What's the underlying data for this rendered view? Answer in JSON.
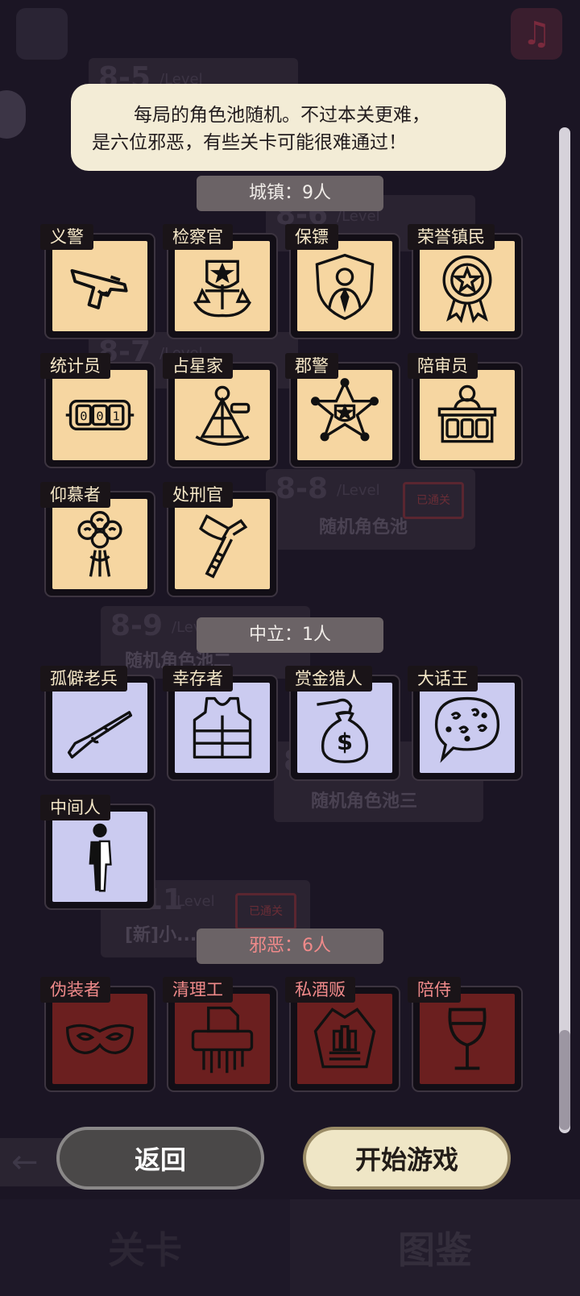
{
  "background": {
    "levels": [
      {
        "num": "8-5",
        "level_text": "/Level",
        "name": ""
      },
      {
        "num": "8-6",
        "level_text": "/Level",
        "name": ""
      },
      {
        "num": "8-7",
        "level_text": "/Level",
        "name": ""
      },
      {
        "num": "8-8",
        "level_text": "/Level",
        "name": "随机角色池"
      },
      {
        "num": "8-9",
        "level_text": "/Level",
        "name": "随机角色池二"
      },
      {
        "num": "8-10",
        "level_text": "",
        "name": "随机角色池三"
      },
      {
        "num": "8-11",
        "level_text": "/Level",
        "name": "[新]小..."
      }
    ],
    "stamp_text": "已通关",
    "tabs": [
      "关卡",
      "图鉴"
    ]
  },
  "tip": {
    "line1": "每局的角色池随机。不过本关更难，",
    "line2": "是六位邪恶，有些关卡可能很难通过！"
  },
  "sections": {
    "town": {
      "label": "城镇：9人"
    },
    "neutral": {
      "label": "中立：1人"
    },
    "evil": {
      "label": "邪恶：6人"
    }
  },
  "roles": {
    "town": [
      {
        "name": "义警",
        "icon": "pistol-icon"
      },
      {
        "name": "检察官",
        "icon": "justice-emblem-icon"
      },
      {
        "name": "保镖",
        "icon": "shield-person-icon"
      },
      {
        "name": "荣誉镇民",
        "icon": "medal-icon"
      },
      {
        "name": "统计员",
        "icon": "counter-icon"
      },
      {
        "name": "占星家",
        "icon": "sextant-icon"
      },
      {
        "name": "郡警",
        "icon": "sheriff-star-icon"
      },
      {
        "name": "陪审员",
        "icon": "jury-box-icon"
      },
      {
        "name": "仰慕者",
        "icon": "bouquet-icon"
      },
      {
        "name": "处刑官",
        "icon": "axe-icon"
      }
    ],
    "neutral": [
      {
        "name": "孤僻老兵",
        "icon": "rifle-icon"
      },
      {
        "name": "幸存者",
        "icon": "vest-icon"
      },
      {
        "name": "赏金猎人",
        "icon": "money-bag-icon"
      },
      {
        "name": "大话王",
        "icon": "speech-bubble-icon"
      },
      {
        "name": "中间人",
        "icon": "half-person-icon"
      }
    ],
    "evil": [
      {
        "name": "伪装者",
        "icon": "mask-icon"
      },
      {
        "name": "清理工",
        "icon": "shredder-icon"
      },
      {
        "name": "私酒贩",
        "icon": "coat-bottles-icon"
      },
      {
        "name": "陪侍",
        "icon": "wine-glass-icon"
      }
    ]
  },
  "buttons": {
    "back": "返回",
    "start": "开始游戏"
  },
  "colors": {
    "town_card": "#f6d6a1",
    "neutral_card": "#cbcbf0",
    "evil_card": "#6b1f1f",
    "evil_text": "#f08a8a"
  }
}
